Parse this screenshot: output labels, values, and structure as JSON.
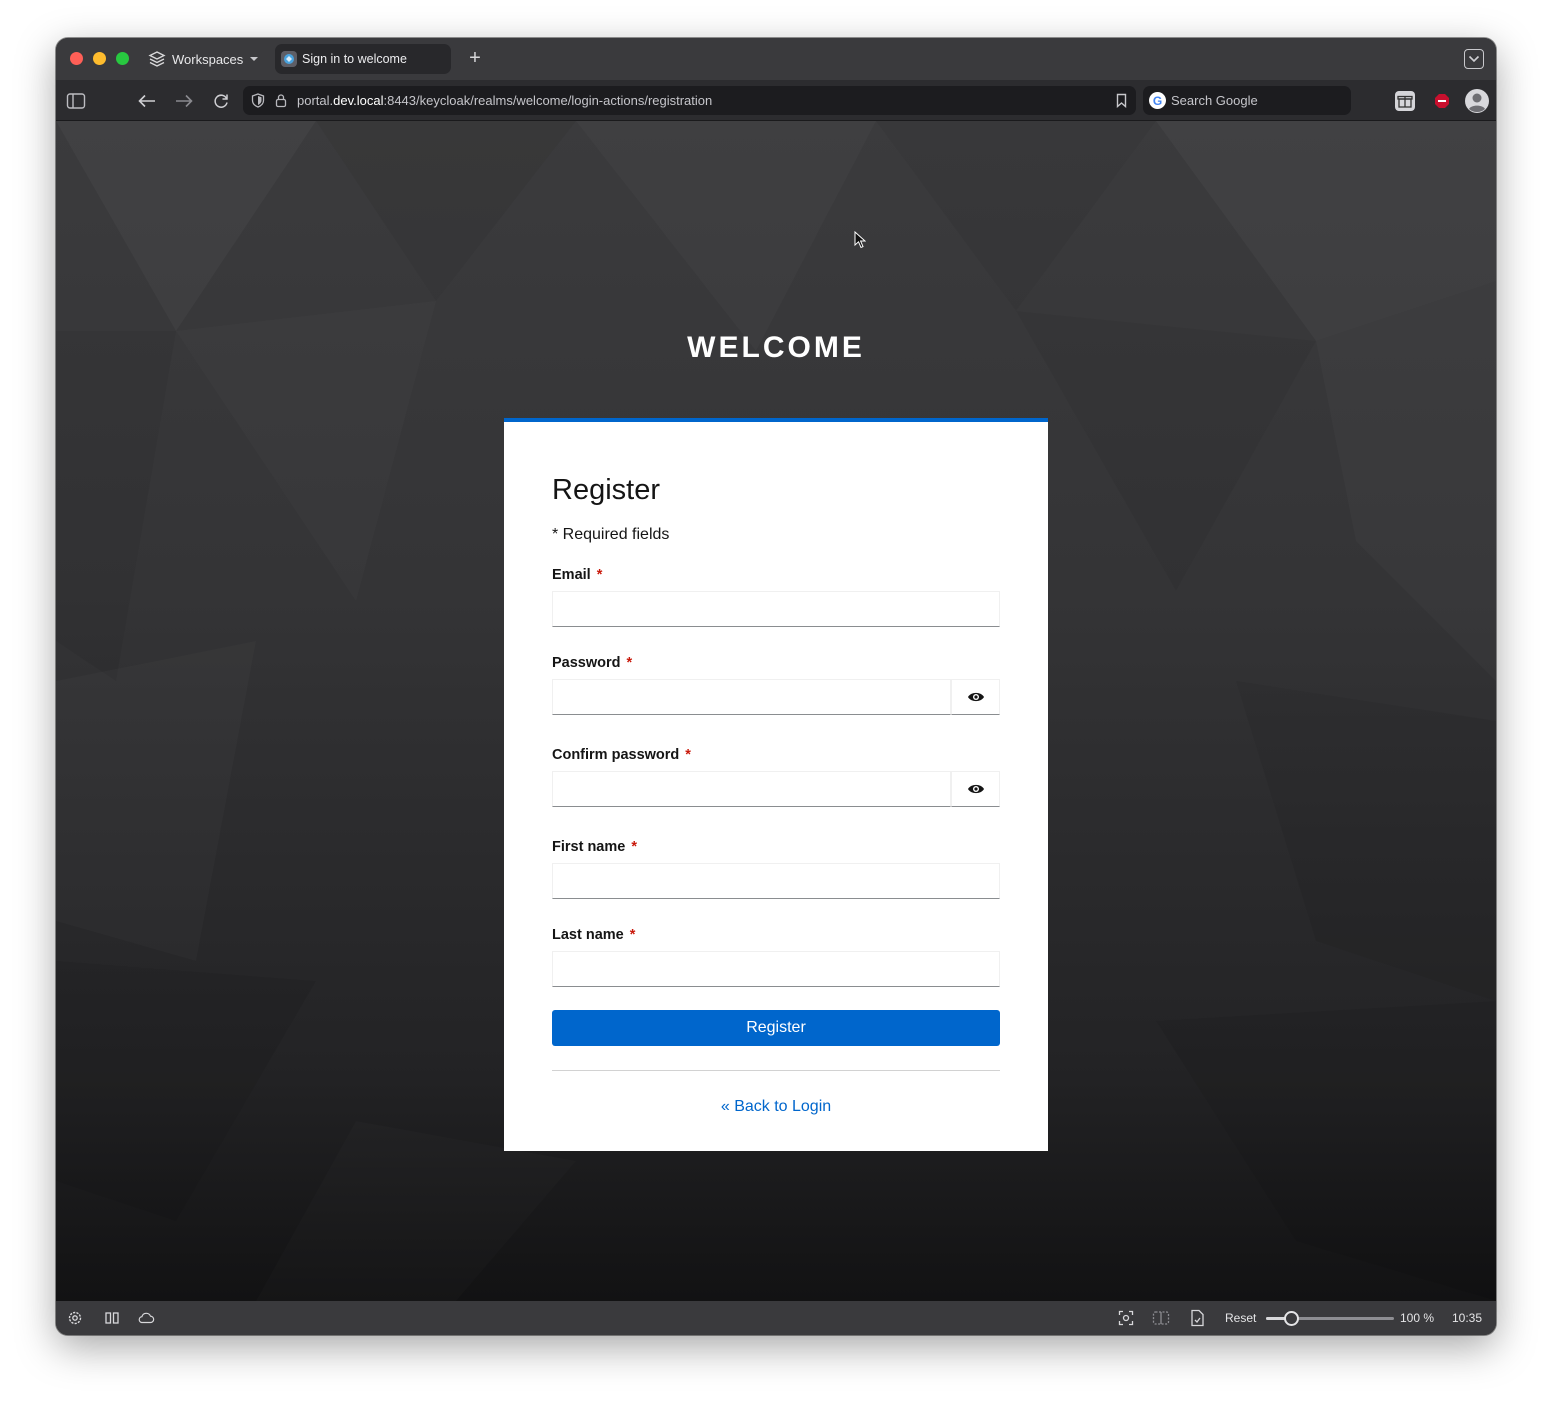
{
  "browser": {
    "workspaces_label": "Workspaces",
    "tab_title": "Sign in to welcome",
    "new_tab": "+",
    "url": {
      "prefix": "portal.",
      "domain": "dev.local",
      "rest": ":8443/keycloak/realms/welcome/login-actions/registration"
    },
    "search_placeholder": "Search Google"
  },
  "page": {
    "brand": "WELCOME",
    "form": {
      "title": "Register",
      "required_note": "* Required fields",
      "required_marker": "*",
      "fields": {
        "email": {
          "label": "Email",
          "value": ""
        },
        "password": {
          "label": "Password",
          "value": ""
        },
        "confirm_password": {
          "label": "Confirm password",
          "value": ""
        },
        "first_name": {
          "label": "First name",
          "value": ""
        },
        "last_name": {
          "label": "Last name",
          "value": ""
        }
      },
      "submit_label": "Register",
      "back_link": "« Back to Login"
    }
  },
  "statusbar": {
    "reset_label": "Reset",
    "zoom_label": "100 %",
    "zoom_fraction": 0.2,
    "clock": "10:35"
  },
  "colors": {
    "accent": "#0066cc",
    "required": "#c9190b"
  }
}
